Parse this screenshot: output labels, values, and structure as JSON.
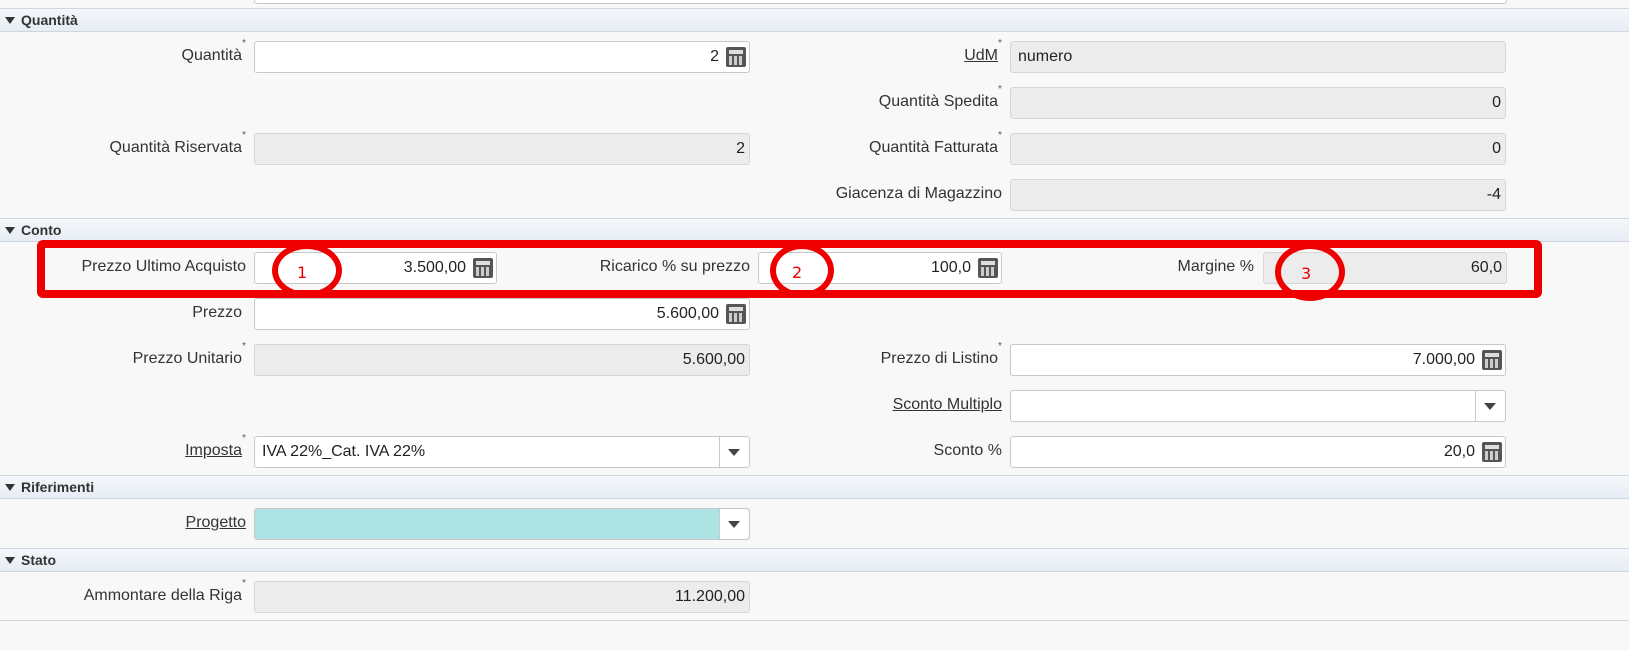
{
  "sections": {
    "quantita": "Quantità",
    "conto": "Conto",
    "riferimenti": "Riferimenti",
    "stato": "Stato"
  },
  "quantita": {
    "quantita_label": "Quantità",
    "quantita_value": "2",
    "udm_label": "UdM",
    "udm_value": "numero",
    "spedita_label": "Quantità Spedita",
    "spedita_value": "0",
    "riservata_label": "Quantità Riservata",
    "riservata_value": "2",
    "fatturata_label": "Quantità Fatturata",
    "fatturata_value": "0",
    "giacenza_label": "Giacenza di Magazzino",
    "giacenza_value": "-4"
  },
  "conto": {
    "prezzo_ultimo_acquisto_label": "Prezzo Ultimo Acquisto",
    "prezzo_ultimo_acquisto_value": "3.500,00",
    "ricarico_label": "Ricarico % su prezzo",
    "ricarico_value": "100,0",
    "margine_label": "Margine %",
    "margine_value": "60,0",
    "prezzo_label": "Prezzo",
    "prezzo_value": "5.600,00",
    "prezzo_unitario_label": "Prezzo Unitario",
    "prezzo_unitario_value": "5.600,00",
    "prezzo_listino_label": "Prezzo di Listino",
    "prezzo_listino_value": "7.000,00",
    "sconto_multiplo_label": "Sconto Multiplo",
    "sconto_multiplo_value": "",
    "imposta_label": "Imposta",
    "imposta_value": "IVA 22%_Cat. IVA 22%",
    "sconto_label": "Sconto %",
    "sconto_value": "20,0"
  },
  "riferimenti": {
    "progetto_label": "Progetto",
    "progetto_value": ""
  },
  "stato": {
    "ammontare_label": "Ammontare della Riga",
    "ammontare_value": "11.200,00"
  },
  "annotations": [
    "1",
    "2",
    "3"
  ],
  "required_mark": "*",
  "colors": {
    "annotation": "#ee0000",
    "progetto_field_bg": "#aee3e3",
    "readonly_bg": "#ececec"
  },
  "icons": {
    "calculator": "calculator-icon",
    "dropdown": "chevron-down-icon",
    "section_toggle": "triangle-down-icon"
  }
}
